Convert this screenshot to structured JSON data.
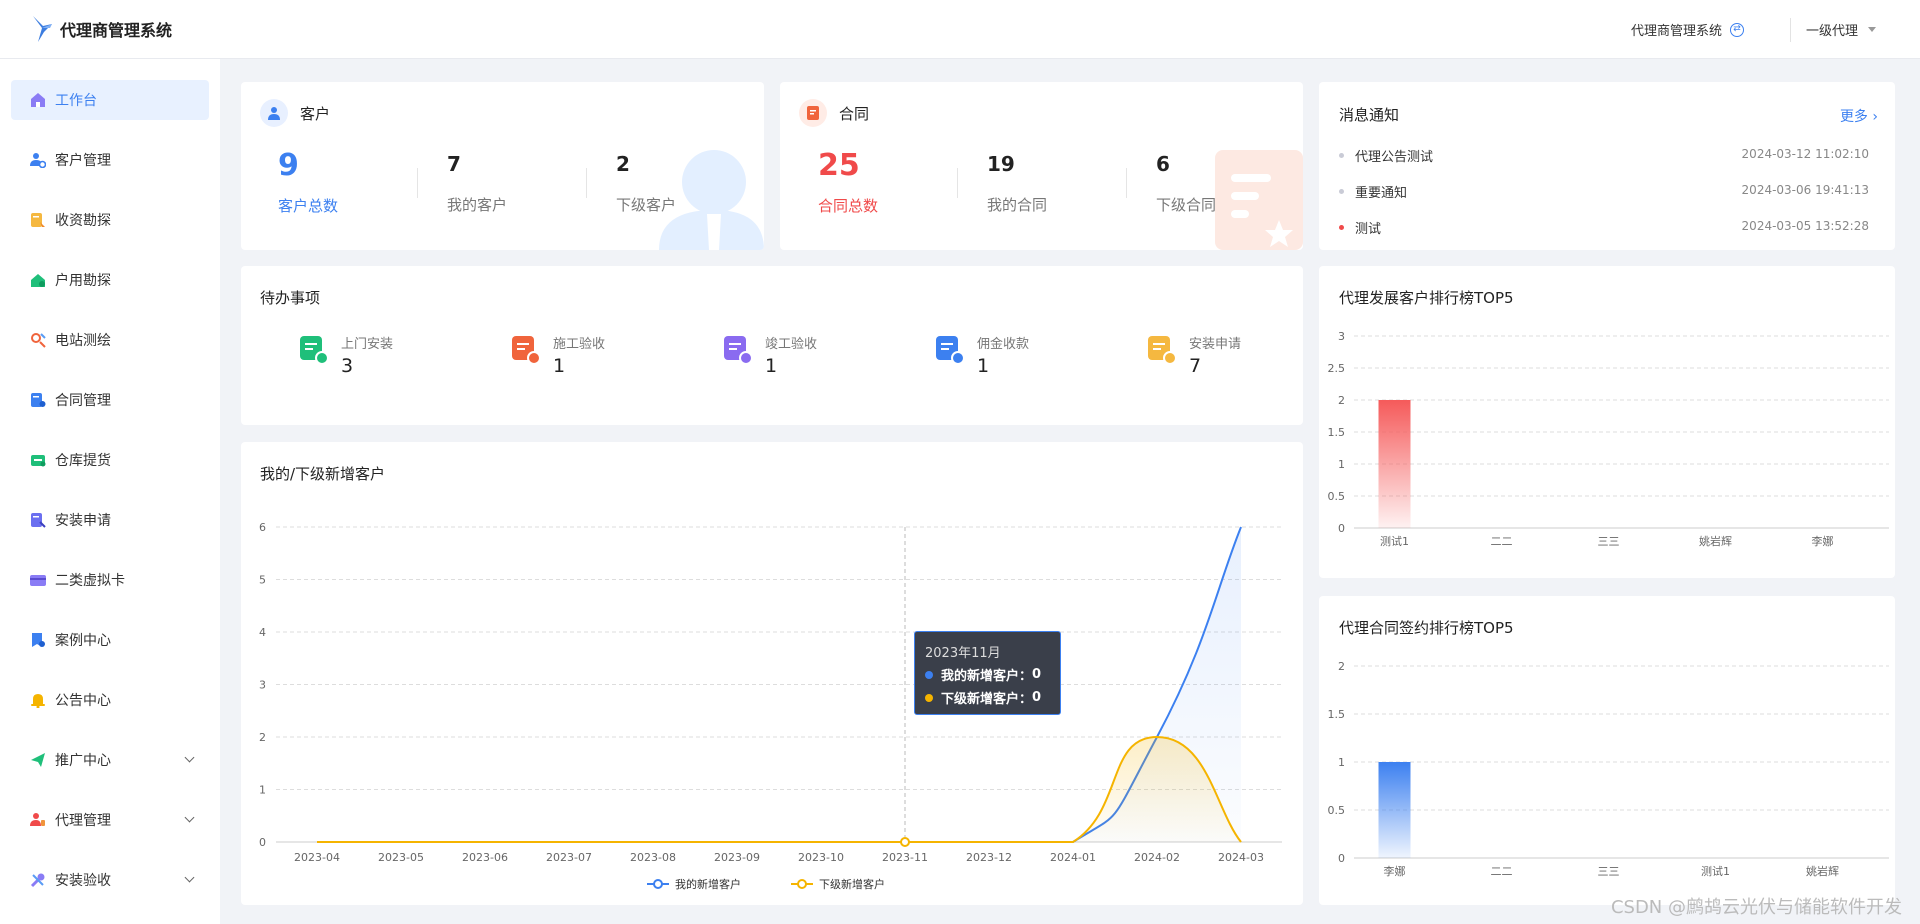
{
  "app": {
    "title": "代理商管理系统"
  },
  "header": {
    "system_label": "代理商管理系统",
    "level_label": "一级代理"
  },
  "sidebar": {
    "items": [
      {
        "label": "工作台",
        "icon": "home-icon",
        "active": true
      },
      {
        "label": "客户管理",
        "icon": "user-gear-icon"
      },
      {
        "label": "收资勘探",
        "icon": "doc-edit-icon"
      },
      {
        "label": "户用勘探",
        "icon": "house-icon"
      },
      {
        "label": "电站测绘",
        "icon": "station-icon"
      },
      {
        "label": "合同管理",
        "icon": "contract-icon"
      },
      {
        "label": "仓库提货",
        "icon": "warehouse-icon"
      },
      {
        "label": "安装申请",
        "icon": "apply-icon"
      },
      {
        "label": "二类虚拟卡",
        "icon": "card-icon"
      },
      {
        "label": "案例中心",
        "icon": "case-icon"
      },
      {
        "label": "公告中心",
        "icon": "bell-icon"
      },
      {
        "label": "推广中心",
        "icon": "send-icon",
        "expandable": true
      },
      {
        "label": "代理管理",
        "icon": "agent-icon",
        "expandable": true
      },
      {
        "label": "安装验收",
        "icon": "tools-icon",
        "expandable": true
      }
    ]
  },
  "customer_card": {
    "title": "客户",
    "total": "9",
    "total_label": "客户总数",
    "mine": "7",
    "mine_label": "我的客户",
    "sub": "2",
    "sub_label": "下级客户"
  },
  "contract_card": {
    "title": "合同",
    "total": "25",
    "total_label": "合同总数",
    "mine": "19",
    "mine_label": "我的合同",
    "sub": "6",
    "sub_label": "下级合同"
  },
  "notices": {
    "title": "消息通知",
    "more": "更多",
    "items": [
      {
        "text": "代理公告测试",
        "time": "2024-03-12 11:02:10",
        "color": "#c9cbd6"
      },
      {
        "text": "重要通知",
        "time": "2024-03-06 19:41:13",
        "color": "#c9cbd6"
      },
      {
        "text": "测试",
        "time": "2024-03-05 13:52:28",
        "color": "#f04a4a"
      }
    ]
  },
  "todo": {
    "title": "待办事项",
    "items": [
      {
        "label": "上门安装",
        "count": "3",
        "icon": "home-install-icon",
        "color": "#1fbf7a"
      },
      {
        "label": "施工验收",
        "count": "1",
        "icon": "construction-check-icon",
        "color": "#f0643c"
      },
      {
        "label": "竣工验收",
        "count": "1",
        "icon": "completion-check-icon",
        "color": "#8a6bf0"
      },
      {
        "label": "佣金收款",
        "count": "1",
        "icon": "commission-icon",
        "color": "#3c80f0"
      },
      {
        "label": "安装申请",
        "count": "7",
        "icon": "install-apply-icon",
        "color": "#f5b840"
      }
    ]
  },
  "watermark": "CSDN @鹧鸪云光伏与储能软件开发",
  "chart_data": [
    {
      "id": "new-customers",
      "type": "line",
      "title": "我的/下级新增客户",
      "categories": [
        "2023-04",
        "2023-05",
        "2023-06",
        "2023-07",
        "2023-08",
        "2023-09",
        "2023-10",
        "2023-11",
        "2023-12",
        "2024-01",
        "2024-02",
        "2024-03"
      ],
      "series": [
        {
          "name": "我的新增客户",
          "color": "#3c80f0",
          "values": [
            0,
            0,
            0,
            0,
            0,
            0,
            0,
            0,
            0,
            0,
            2,
            6
          ]
        },
        {
          "name": "下级新增客户",
          "color": "#f5b400",
          "values": [
            0,
            0,
            0,
            0,
            0,
            0,
            0,
            0,
            0,
            0,
            2,
            0
          ]
        }
      ],
      "ylim": [
        0,
        6
      ],
      "yticks": [
        "0",
        "1",
        "2",
        "3",
        "4",
        "5",
        "6"
      ],
      "grid": true,
      "legend": "bottom",
      "tooltip": {
        "title": "2023年11月",
        "rows": [
          {
            "label": "我的新增客户：",
            "value": "0"
          },
          {
            "label": "下级新增客户：",
            "value": "0"
          }
        ]
      }
    },
    {
      "id": "customer-top5",
      "type": "bar",
      "title": "代理发展客户排行榜TOP5",
      "categories": [
        "测试1",
        "二二",
        "三三",
        "姚岩辉",
        "李娜"
      ],
      "values": [
        2,
        0,
        0,
        0,
        0
      ],
      "color": "#f55a5a",
      "ylim": [
        0,
        3
      ],
      "yticks": [
        "0",
        "0.5",
        "1",
        "1.5",
        "2",
        "2.5",
        "3"
      ],
      "grid": true
    },
    {
      "id": "contract-top5",
      "type": "bar",
      "title": "代理合同签约排行榜TOP5",
      "categories": [
        "李娜",
        "二二",
        "三三",
        "测试1",
        "姚岩辉"
      ],
      "values": [
        1,
        0,
        0,
        0,
        0
      ],
      "color": "#3c80f0",
      "ylim": [
        0,
        2
      ],
      "yticks": [
        "0",
        "0.5",
        "1",
        "1.5",
        "2"
      ],
      "grid": true
    }
  ]
}
